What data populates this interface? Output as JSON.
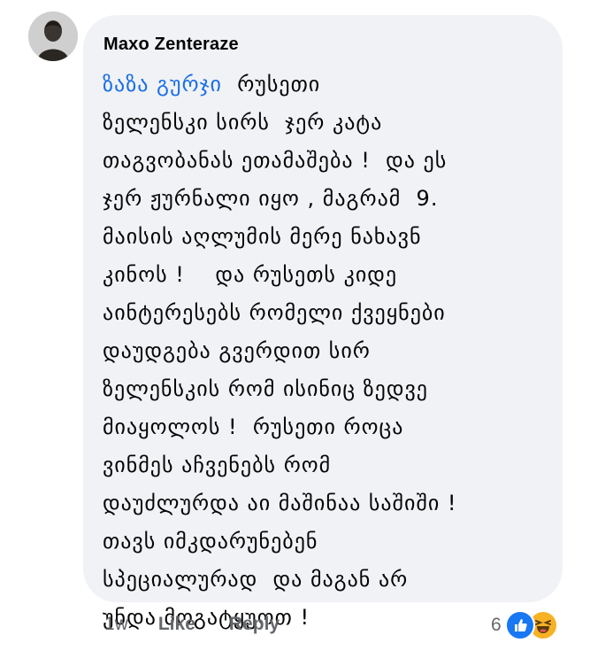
{
  "comment": {
    "author": "Maxo Zenteraze",
    "mention": "ზაზა გურჯი",
    "lines": [
      "  რუსეთი",
      "ზელენსკი სირს  ჯერ კატა",
      "თაგვობანას ეთამაშება !  და ეს",
      "ჯერ ჟურნალი იყო , მაგრამ  9.",
      "მაისის აღლუმის მერე ნახავნ",
      "კინოს !    და რუსეთს კიდე",
      "აინტერესებს რომელი ქვეყნები",
      "დაუდგება გვერდით სირ",
      "ზელენსკის რომ ისინიც ზედვე",
      "მიაყოლოს !  რუსეთი როცა",
      "ვინმეს აჩვენებს რომ",
      "დაუძლურდა აი მაშინაა საშიში !",
      "თავს იმკდარუნებენ",
      "სპეციალურად  და მაგან არ",
      "უნდა მოგატყუოთ !"
    ]
  },
  "actions": {
    "time": "1w",
    "like_label": "Like",
    "reply_label": "Reply"
  },
  "reactions": {
    "count": "6",
    "icons": [
      "like-icon",
      "haha-icon"
    ],
    "colors": {
      "like": "#1877f2",
      "haha": "#f7b125"
    }
  }
}
